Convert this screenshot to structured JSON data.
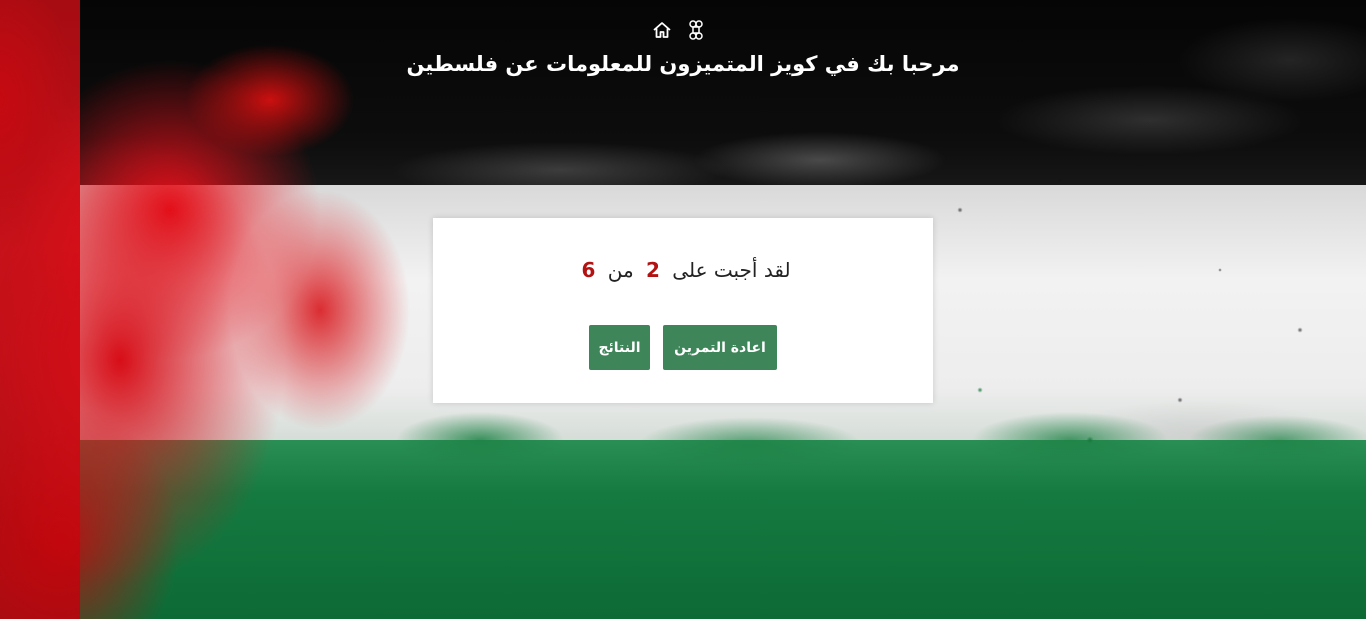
{
  "header": {
    "icons": [
      "home-icon",
      "command-icon"
    ],
    "title": "مرحبا بك في كويز المتميزون للمعلومات عن فلسطين"
  },
  "result": {
    "prefix": "لقد أجبت على",
    "correct": "2",
    "middle": "من",
    "total": "6"
  },
  "actions": {
    "restart_label": "اعادة التمرين",
    "results_label": "النتائج"
  },
  "colors": {
    "button_bg": "#3e8559",
    "score_number": "#b31212",
    "card_bg": "#ffffff"
  }
}
